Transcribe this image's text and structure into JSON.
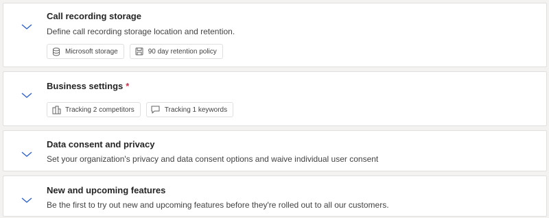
{
  "colors": {
    "accent": "#2b60c8",
    "required": "#c4314b"
  },
  "sections": [
    {
      "title": "Call recording storage",
      "description": "Define call recording storage location and retention.",
      "tags": [
        {
          "icon": "database-icon",
          "label": "Microsoft storage"
        },
        {
          "icon": "save-icon",
          "label": "90 day retention policy"
        }
      ]
    },
    {
      "title": "Business settings",
      "required_marker": "*",
      "tags": [
        {
          "icon": "competitors-icon",
          "label": "Tracking 2 competitors"
        },
        {
          "icon": "comment-icon",
          "label": "Tracking 1 keywords"
        }
      ]
    },
    {
      "title": "Data consent and privacy",
      "description": "Set your organization's privacy and data consent options and waive individual user consent"
    },
    {
      "title": "New and upcoming features",
      "description": "Be the first to try out new and upcoming features before they're rolled out to all our customers."
    }
  ]
}
